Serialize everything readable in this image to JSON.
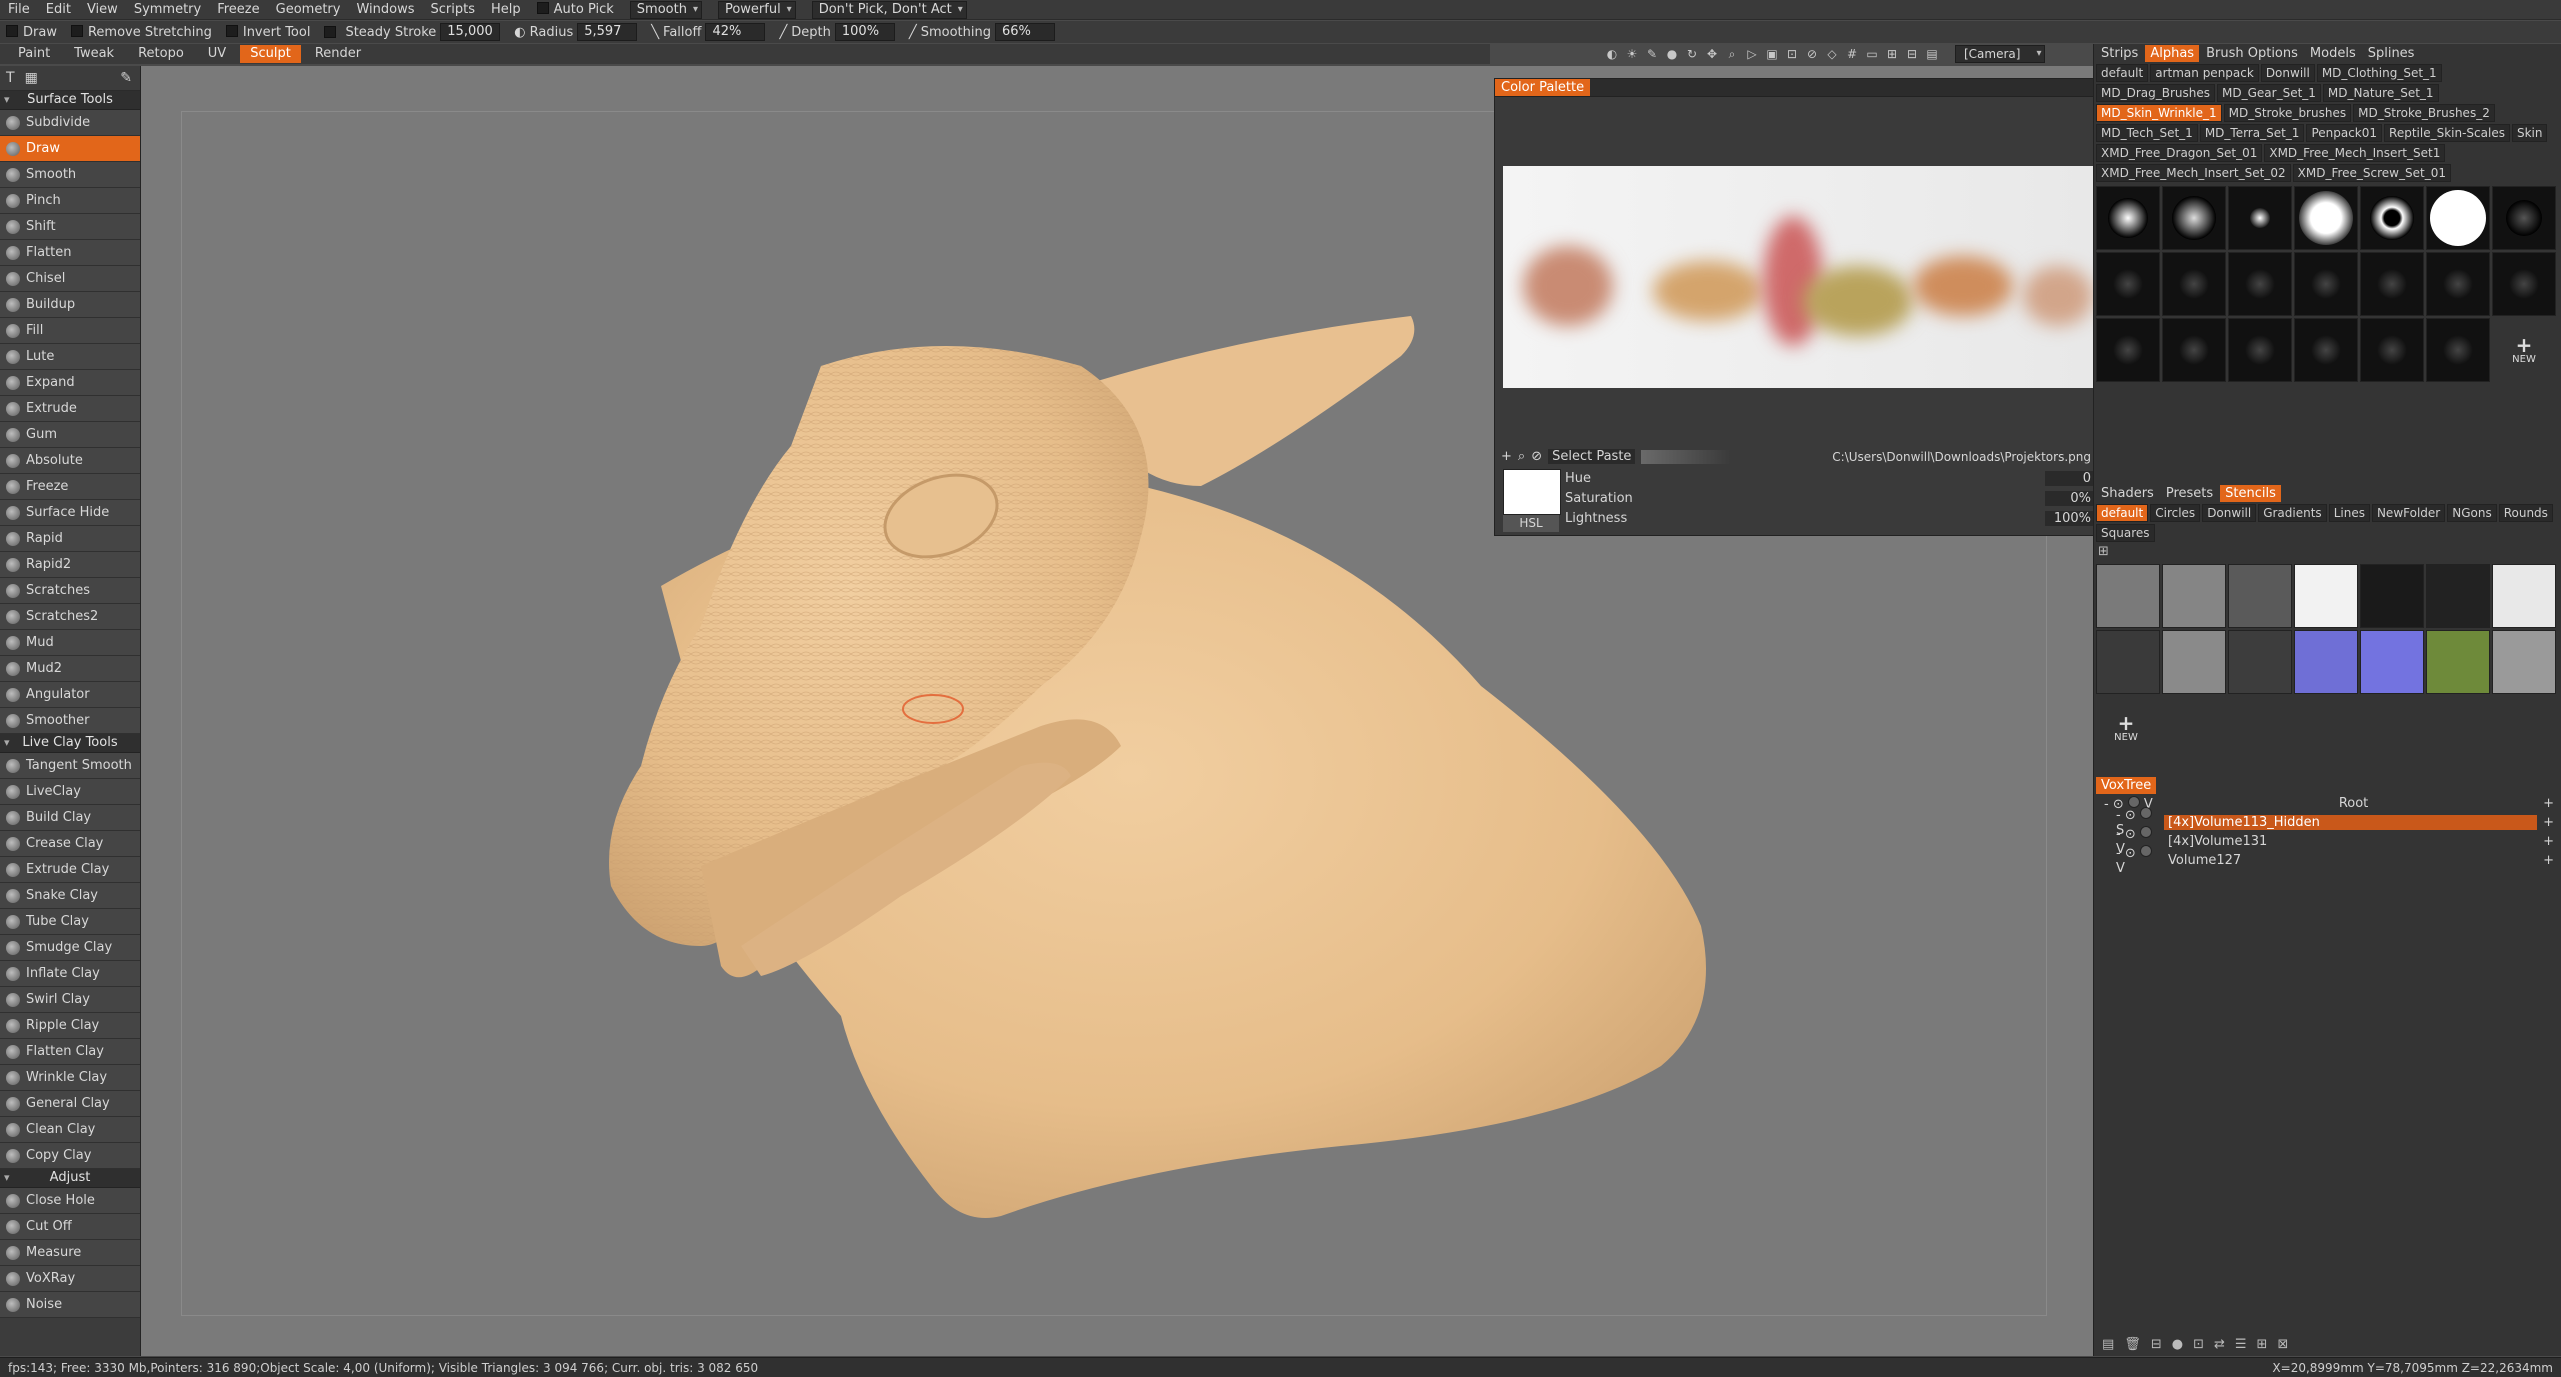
{
  "menu": {
    "items": [
      "File",
      "Edit",
      "View",
      "Symmetry",
      "Freeze",
      "Geometry",
      "Windows",
      "Scripts",
      "Help"
    ],
    "auto_pick": "Auto Pick",
    "smooth": "Smooth",
    "powerful": "Powerful",
    "dont_pick": "Don't Pick, Don't Act"
  },
  "toolbar": {
    "draw": "Draw",
    "remove_stretching": "Remove Stretching",
    "invert_tool": "Invert Tool",
    "steady_stroke_label": "Steady Stroke",
    "steady_stroke_value": "15,000",
    "radius_label": "Radius",
    "radius_value": "5,597",
    "falloff_label": "Falloff",
    "falloff_value": "42%",
    "depth_label": "Depth",
    "depth_value": "100%",
    "smoothing_label": "Smoothing",
    "smoothing_value": "66%"
  },
  "rooms": [
    {
      "label": "Paint",
      "active": false
    },
    {
      "label": "Tweak",
      "active": false
    },
    {
      "label": "Retopo",
      "active": false
    },
    {
      "label": "UV",
      "active": false
    },
    {
      "label": "Sculpt",
      "active": true
    },
    {
      "label": "Render",
      "active": false
    }
  ],
  "camera": "[Camera]",
  "tools": {
    "surface_title": "Surface Tools",
    "surface": [
      "Subdivide",
      "Draw",
      "Smooth",
      "Pinch",
      "Shift",
      "Flatten",
      "Chisel",
      "Buildup",
      "Fill",
      "Lute",
      "Expand",
      "Extrude",
      "Gum",
      "Absolute",
      "Freeze",
      "Surface Hide",
      "Rapid",
      "Rapid2",
      "Scratches",
      "Scratches2",
      "Mud",
      "Mud2",
      "Angulator",
      "Smoother"
    ],
    "surface_active": "Draw",
    "liveclay_title": "Live Clay  Tools",
    "liveclay": [
      "Tangent Smooth",
      "LiveClay",
      "Build Clay",
      "Crease Clay",
      "Extrude Clay",
      "Snake Clay",
      "Tube Clay",
      "Smudge Clay",
      "Inflate Clay",
      "Swirl Clay",
      "Ripple Clay",
      "Flatten Clay",
      "Wrinkle Clay",
      "General Clay",
      "Clean Clay",
      "Copy Clay"
    ],
    "adjust_title": "Adjust",
    "adjust": [
      "Close Hole",
      "Cut Off",
      "Measure",
      "VoXRay",
      "Noise"
    ]
  },
  "color_palette": {
    "title": "Color Palette",
    "select_paste": "Select Paste",
    "path": "C:\\Users\\Donwill\\Downloads\\Projektors.png",
    "hue_label": "Hue",
    "hue_value": "0",
    "saturation_label": "Saturation",
    "saturation_value": "0%",
    "lightness_label": "Lightness",
    "lightness_value": "100%",
    "mode": "HSL"
  },
  "right_top_tabs": [
    {
      "label": "Strips",
      "active": false
    },
    {
      "label": "Alphas",
      "active": true
    },
    {
      "label": "Brush Options",
      "active": false
    },
    {
      "label": "Models",
      "active": false
    },
    {
      "label": "Splines",
      "active": false
    }
  ],
  "alpha_sets": [
    {
      "label": "default",
      "active": false
    },
    {
      "label": "artman penpack",
      "active": false
    },
    {
      "label": "Donwill",
      "active": false
    },
    {
      "label": "MD_Clothing_Set_1",
      "active": false
    },
    {
      "label": "MD_Drag_Brushes",
      "active": false
    },
    {
      "label": "MD_Gear_Set_1",
      "active": false
    },
    {
      "label": "MD_Nature_Set_1",
      "active": false
    },
    {
      "label": "MD_Skin_Wrinkle_1",
      "active": true
    },
    {
      "label": "MD_Stroke_brushes",
      "active": false
    },
    {
      "label": "MD_Stroke_Brushes_2",
      "active": false
    },
    {
      "label": "MD_Tech_Set_1",
      "active": false
    },
    {
      "label": "MD_Terra_Set_1",
      "active": false
    },
    {
      "label": "Penpack01",
      "active": false
    },
    {
      "label": "Reptile_Skin-Scales",
      "active": false
    },
    {
      "label": "Skin",
      "active": false
    },
    {
      "label": "XMD_Free_Dragon_Set_01",
      "active": false
    },
    {
      "label": "XMD_Free_Mech_Insert_Set1",
      "active": false
    },
    {
      "label": "XMD_Free_Mech_Insert_Set_02",
      "active": false
    },
    {
      "label": "XMD_Free_Screw_Set_01",
      "active": false
    }
  ],
  "new_label": "NEW",
  "right_mid_tabs": [
    {
      "label": "Shaders",
      "active": false
    },
    {
      "label": "Presets",
      "active": false
    },
    {
      "label": "Stencils",
      "active": true
    }
  ],
  "stencil_sets": [
    {
      "label": "default",
      "active": true
    },
    {
      "label": "Circles",
      "active": false
    },
    {
      "label": "Donwill",
      "active": false
    },
    {
      "label": "Gradients",
      "active": false
    },
    {
      "label": "Lines",
      "active": false
    },
    {
      "label": "NewFolder",
      "active": false
    },
    {
      "label": "NGons",
      "active": false
    },
    {
      "label": "Rounds",
      "active": false
    },
    {
      "label": "Squares",
      "active": false
    }
  ],
  "stencil_colors": [
    "#7a7a7a",
    "#858585",
    "#5a5a5a",
    "#f2f2f2",
    "#1a1a1a",
    "#222222",
    "#e8e8e8",
    "#3a3a3a",
    "#8a8a8a",
    "#3d3d3d",
    "#6f6fd6",
    "#7373e0",
    "#6e8a3a",
    "#9a9a9a"
  ],
  "voxtree": {
    "title": "VoxTree",
    "root": "Root",
    "items": [
      {
        "type": "S",
        "name": "[4x]Volume113_Hidden",
        "selected": true
      },
      {
        "type": "V",
        "name": "[4x]Volume131",
        "selected": false
      },
      {
        "type": "V",
        "name": "Volume127",
        "selected": false
      }
    ]
  },
  "status": {
    "left": "fps:143;    Free: 3330  Mb,Pointers: 316 890;Object Scale: 4,00 (Uniform);  Visible  Triangles: 3 094 766;  Curr. obj. tris: 3 082 650",
    "right": "X=20,8999mm  Y=78,7095mm  Z=22,2634mm"
  }
}
